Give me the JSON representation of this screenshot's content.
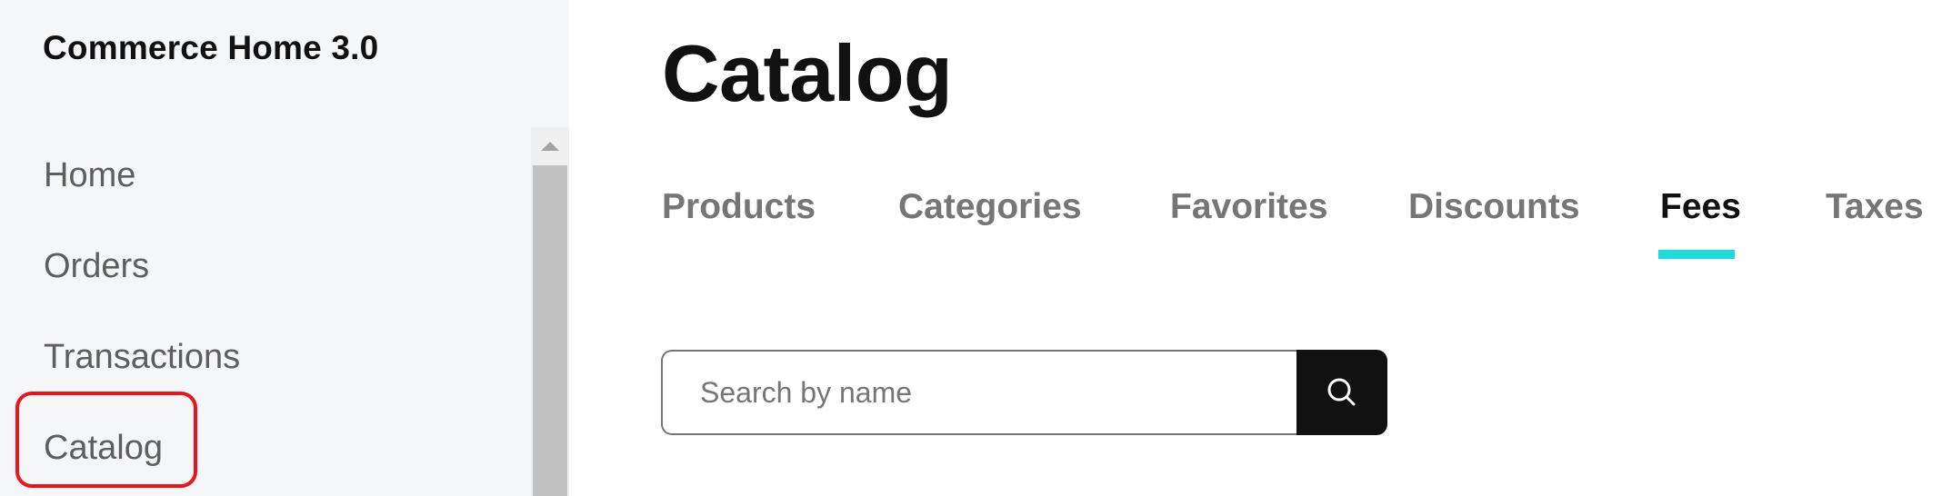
{
  "sidebar": {
    "app_title": "Commerce Home 3.0",
    "items": [
      {
        "label": "Home"
      },
      {
        "label": "Orders"
      },
      {
        "label": "Transactions"
      },
      {
        "label": "Catalog",
        "highlighted": true
      }
    ],
    "highlight_color": "#e8141e"
  },
  "main": {
    "title": "Catalog",
    "tabs": [
      {
        "label": "Products"
      },
      {
        "label": "Categories"
      },
      {
        "label": "Favorites"
      },
      {
        "label": "Discounts"
      },
      {
        "label": "Fees",
        "active": true
      },
      {
        "label": "Taxes"
      }
    ],
    "active_tab_color": "#1ddcdc",
    "search": {
      "placeholder": "Search by name",
      "value": "",
      "button_icon": "search-icon"
    }
  }
}
